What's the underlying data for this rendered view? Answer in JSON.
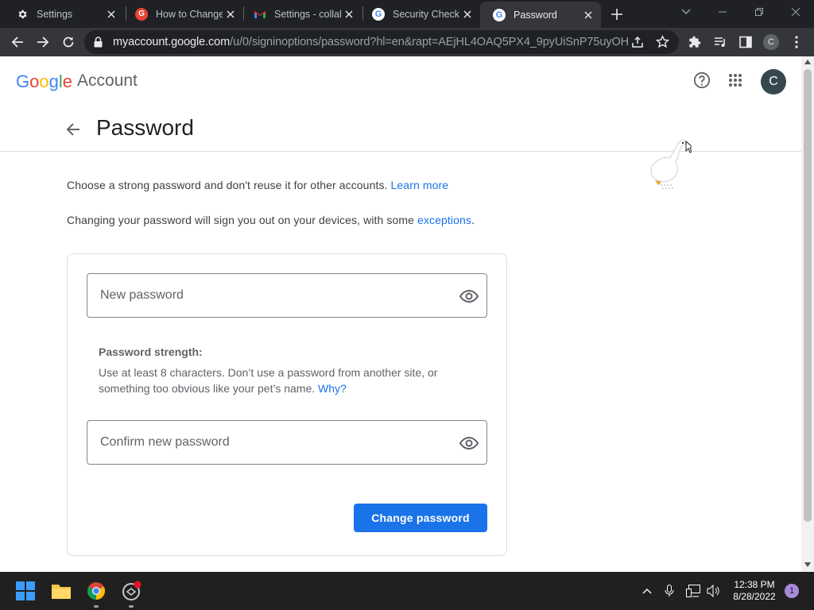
{
  "browser": {
    "tabs": [
      {
        "label": "Settings",
        "icon": "gear-icon"
      },
      {
        "label": "How to Change",
        "icon": "red-g-icon"
      },
      {
        "label": "Settings - collab",
        "icon": "gmail-icon"
      },
      {
        "label": "Security Checkup",
        "icon": "google-icon"
      },
      {
        "label": "Password",
        "icon": "google-icon",
        "active": true
      }
    ],
    "url_host": "myaccount.google.com",
    "url_path": "/u/0/signinoptions/password?hl=en&rapt=AEjHL4OAQ5PX4_9pyUiSnP75uyOH...",
    "profile_initial": "C"
  },
  "header": {
    "logo": [
      "G",
      "o",
      "o",
      "g",
      "l",
      "e"
    ],
    "logo_colors": [
      "#4285f4",
      "#ea4335",
      "#fbbc05",
      "#4285f4",
      "#34a853",
      "#ea4335"
    ],
    "account_label": "Account",
    "avatar_initial": "C"
  },
  "page": {
    "title": "Password",
    "intro_text": "Choose a strong password and don't reuse it for other accounts. ",
    "intro_link": "Learn more",
    "signout_text": "Changing your password will sign you out on your devices, with some ",
    "signout_link": "exceptions",
    "signout_end": "."
  },
  "form": {
    "new_password_placeholder": "New password",
    "strength_label": "Password strength:",
    "strength_help": "Use at least 8 characters. Don’t use a password from another site, or something too obvious like your pet’s name. ",
    "strength_link": "Why?",
    "confirm_placeholder": "Confirm new password",
    "submit_label": "Change password"
  },
  "taskbar": {
    "time": "12:38 PM",
    "date": "8/28/2022",
    "notification_count": "1"
  },
  "colors": {
    "accent": "#1a73e8",
    "chrome_dark": "#202124"
  }
}
